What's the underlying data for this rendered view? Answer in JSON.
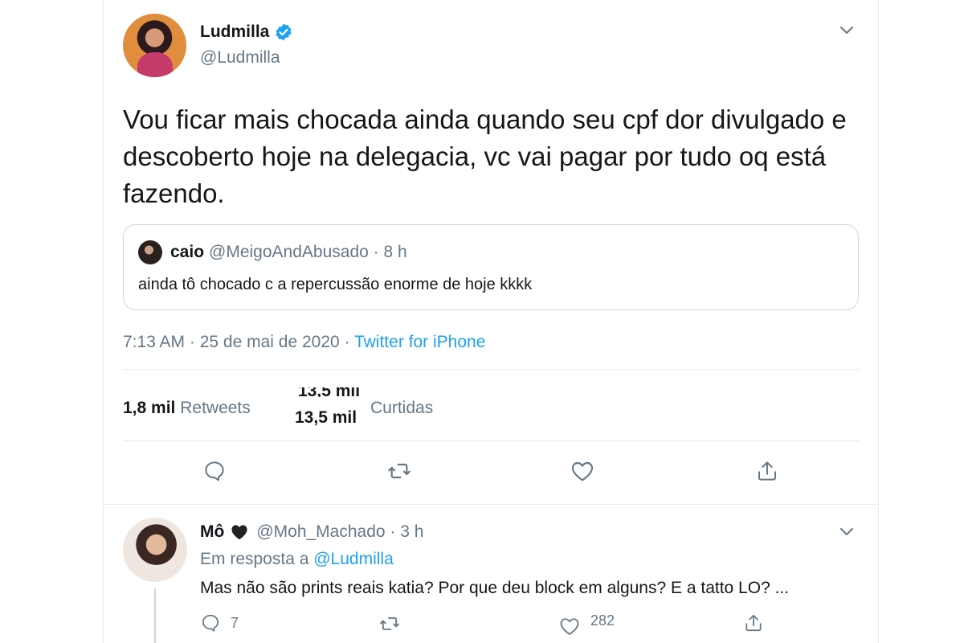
{
  "tweet": {
    "display_name": "Ludmilla",
    "handle": "@Ludmilla",
    "text": "Vou ficar mais chocada ainda quando seu cpf dor divulgado e descoberto hoje na delegacia, vc vai pagar por tudo oq está fazendo.",
    "quote": {
      "name": "caio",
      "meta": "@MeigoAndAbusado · 8 h",
      "text": "ainda tô chocado c a repercussão enorme de hoje kkkk"
    },
    "time": "7:13 AM · 25 de mai de 2020 · ",
    "source": "Twitter for iPhone",
    "retweets_count": "1,8 mil",
    "retweets_label": "Retweets",
    "likes_count": "13,5 mil",
    "likes_label": "Curtidas"
  },
  "reply": {
    "name": "Mô",
    "meta": "@Moh_Machado · 3 h",
    "reply_prefix": "Em resposta a ",
    "reply_to": "@Ludmilla",
    "text": "Mas não são prints reais katia? Por que deu block em alguns? E a tatto LO? ...",
    "reply_count": "7",
    "like_count": "282"
  },
  "colors": {
    "link": "#1da1f2",
    "secondary_text": "#657786",
    "border": "#e6ecf0",
    "verified": "#1da1f2"
  },
  "icons": [
    "verified-badge-icon",
    "chevron-down-icon",
    "reply-icon",
    "retweet-icon",
    "like-icon",
    "share-icon",
    "heart-emoji-icon"
  ]
}
